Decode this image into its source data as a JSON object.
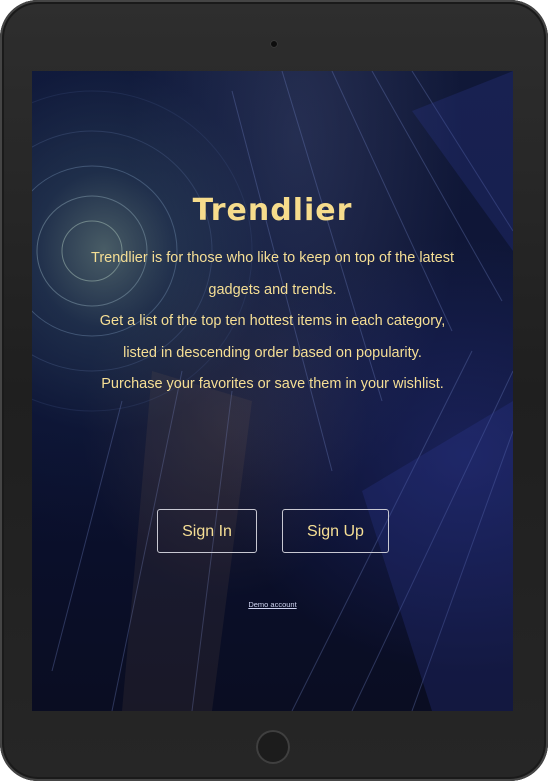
{
  "app": {
    "title": "Trendlier"
  },
  "intro": {
    "lines": [
      "Trendlier is for those who like to keep on top of the latest",
      "gadgets and trends.",
      "Get a list of the top ten hottest items in each category,",
      "listed in descending order based on popularity.",
      "Purchase your favorites or save them in your wishlist."
    ]
  },
  "actions": {
    "sign_in": "Sign In",
    "sign_up": "Sign Up",
    "demo": "Demo account"
  },
  "colors": {
    "accent_text": "#f6dc8c",
    "background": "#0e1536",
    "button_border": "#c8c8d2"
  }
}
